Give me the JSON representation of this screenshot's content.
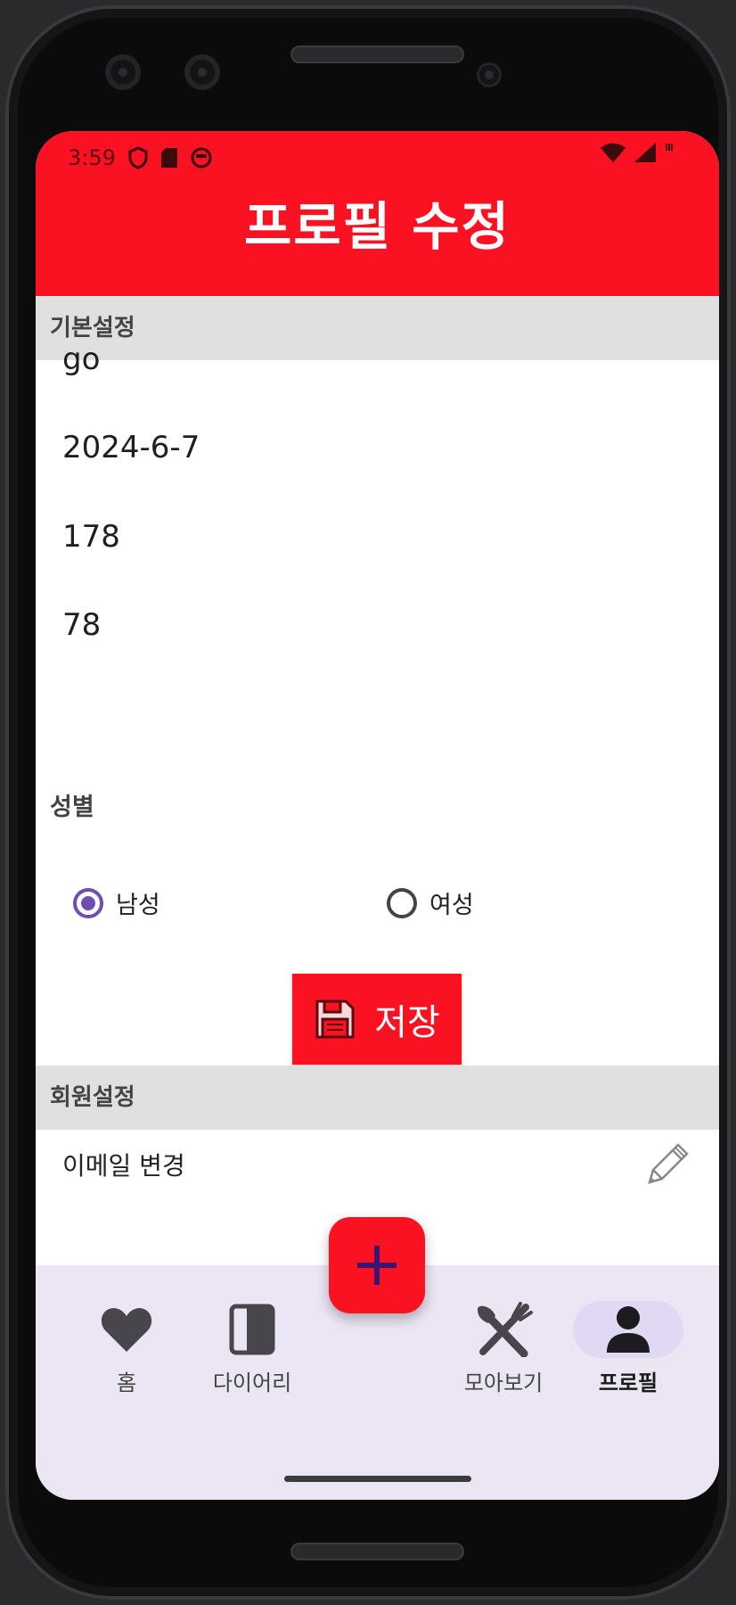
{
  "status_bar": {
    "time": "3:59"
  },
  "header": {
    "title": "프로필 수정"
  },
  "basic_section": {
    "title": "기본설정",
    "fields": [
      "go",
      "2024-6-7",
      "178",
      "78"
    ]
  },
  "gender": {
    "label": "성별",
    "options": [
      {
        "label": "남성",
        "selected": true
      },
      {
        "label": "여성",
        "selected": false
      }
    ]
  },
  "save_button": {
    "label": "저장"
  },
  "member_section": {
    "title": "회원설정",
    "email_change": "이메일 변경"
  },
  "bottom_nav": {
    "items": [
      {
        "label": "홈",
        "icon": "heart-icon"
      },
      {
        "label": "다이어리",
        "icon": "book-icon"
      },
      {
        "label": "모아보기",
        "icon": "utensils-icon"
      },
      {
        "label": "프로필",
        "icon": "person-icon",
        "active": true
      }
    ],
    "fab_icon": "plus-icon"
  },
  "colors": {
    "primary": "#fa1122",
    "accent": "#6e4fb0",
    "nav_bg": "#ece5f3",
    "section_bg": "#e0e0e0"
  }
}
